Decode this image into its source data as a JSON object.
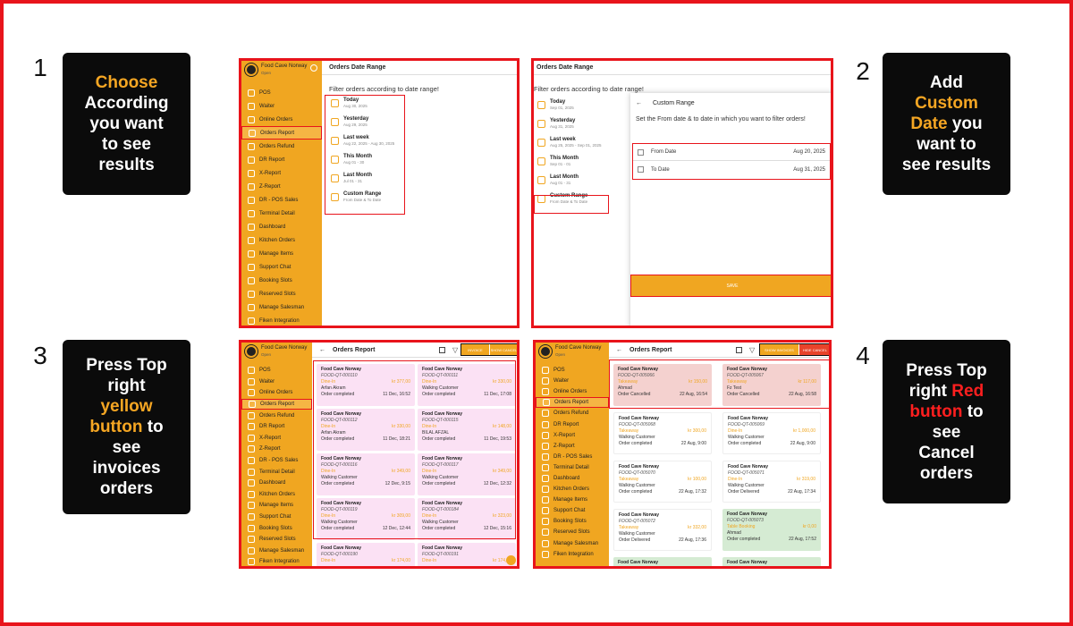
{
  "steps": [
    {
      "num": "1",
      "lines": [
        [
          {
            "t": "Choose",
            "c": "y"
          }
        ],
        [
          {
            "t": "According"
          }
        ],
        [
          {
            "t": "you want"
          }
        ],
        [
          {
            "t": "to see"
          }
        ],
        [
          {
            "t": "results"
          }
        ]
      ]
    },
    {
      "num": "2",
      "lines": [
        [
          {
            "t": "Add"
          }
        ],
        [
          {
            "t": "Custom",
            "c": "y"
          }
        ],
        [
          {
            "t": "Date",
            "c": "y"
          },
          {
            "t": " you"
          }
        ],
        [
          {
            "t": "want to"
          }
        ],
        [
          {
            "t": "see results"
          }
        ]
      ]
    },
    {
      "num": "3",
      "lines": [
        [
          {
            "t": "Press Top"
          }
        ],
        [
          {
            "t": "right"
          }
        ],
        [
          {
            "t": "yellow",
            "c": "y"
          }
        ],
        [
          {
            "t": "button",
            "c": "y"
          },
          {
            "t": " to"
          }
        ],
        [
          {
            "t": "see"
          }
        ],
        [
          {
            "t": "invoices"
          }
        ],
        [
          {
            "t": "orders"
          }
        ]
      ]
    },
    {
      "num": "4",
      "lines": [
        [
          {
            "t": "Press Top"
          }
        ],
        [
          {
            "t": "right "
          },
          {
            "t": "Red",
            "c": "r"
          }
        ],
        [
          {
            "t": "button",
            "c": "r"
          },
          {
            "t": " to"
          }
        ],
        [
          {
            "t": "see"
          }
        ],
        [
          {
            "t": "Cancel"
          }
        ],
        [
          {
            "t": "orders"
          }
        ]
      ]
    }
  ],
  "app": {
    "brand": "Food Cave Norway",
    "brand_sub": "Open"
  },
  "menu_full": [
    "POS",
    "Waiter",
    "Online Orders",
    "Orders Report",
    "Orders Refund",
    "DR Report",
    "X-Report",
    "Z-Report",
    "DR - POS Sales",
    "Terminal Detail",
    "Dashboard",
    "Kitchen Orders",
    "Manage Items",
    "Support Chat",
    "Booking Slots",
    "Reserved Slots",
    "Manage Salesman",
    "Fiken Integration"
  ],
  "shot1": {
    "title": "Orders Date Range",
    "prompt": "Filter orders according to date range!",
    "ranges": [
      {
        "label": "Today",
        "sub": "Aug 30, 2025"
      },
      {
        "label": "Yesterday",
        "sub": "Aug 29, 2025"
      },
      {
        "label": "Last week",
        "sub": "Aug 22, 2025 - Aug 30, 2025"
      },
      {
        "label": "This Month",
        "sub": "Aug 01 - 30"
      },
      {
        "label": "Last Month",
        "sub": "Jul 01 - 31"
      },
      {
        "label": "Custom Range",
        "sub": "From Date & To Date"
      }
    ]
  },
  "shot2": {
    "title": "Orders Date Range",
    "prompt": "Filter orders according to date range!",
    "ranges": [
      {
        "label": "Today",
        "sub": "Sep 01, 2025"
      },
      {
        "label": "Yesterday",
        "sub": "Aug 31, 2025"
      },
      {
        "label": "Last week",
        "sub": "Aug 25, 2025 - Sep 01, 2025"
      },
      {
        "label": "This Month",
        "sub": "Sep 01 - 01"
      },
      {
        "label": "Last Month",
        "sub": "Aug 01 - 31"
      },
      {
        "label": "Custom Range",
        "sub": "From Date & To Date"
      }
    ],
    "dialog_title": "Custom Range",
    "dialog_text": "Set the From date & to date in which you want to filter orders!",
    "from_label": "From Date",
    "from_value": "Aug 20, 2025",
    "to_label": "To Date",
    "to_value": "Aug 31, 2025",
    "save": "SAVE"
  },
  "shot3": {
    "title": "Orders Report",
    "btn_y": "INVOICE",
    "btn_r": "SHOW CANCEL",
    "cards": [
      {
        "n": "Food Cave Norway",
        "id": "FOOD-QT-000110",
        "t": "Dine-In",
        "a": "kr 377,00",
        "c": "Arfan Akram",
        "s": "Order completed",
        "d": "11 Dec, 16:52"
      },
      {
        "n": "Food Cave Norway",
        "id": "FOOD-QT-000111",
        "t": "Dine-In",
        "a": "kr 330,00",
        "c": "Walking Customer",
        "s": "Order completed",
        "d": "11 Dec, 17:08"
      },
      {
        "n": "Food Cave Norway",
        "id": "FOOD-QT-000112",
        "t": "Dine-In",
        "a": "kr 330,00",
        "c": "Arfan Akram",
        "s": "Order completed",
        "d": "11 Dec, 18:21"
      },
      {
        "n": "Food Cave Norway",
        "id": "FOOD-QT-000115",
        "t": "Dine-In",
        "a": "kr 148,00",
        "c": "BILAL AFZAL",
        "s": "Order completed",
        "d": "11 Dec, 19:53"
      },
      {
        "n": "Food Cave Norway",
        "id": "FOOD-QT-000116",
        "t": "Dine-In",
        "a": "kr 349,00",
        "c": "Walking Customer",
        "s": "Order completed",
        "d": "12 Dec, 9:15"
      },
      {
        "n": "Food Cave Norway",
        "id": "FOOD-QT-000117",
        "t": "Dine-In",
        "a": "kr 349,00",
        "c": "Walking Customer",
        "s": "Order completed",
        "d": "12 Dec, 12:32"
      },
      {
        "n": "Food Cave Norway",
        "id": "FOOD-QT-000119",
        "t": "Dine-In",
        "a": "kr 309,00",
        "c": "Walking Customer",
        "s": "Order completed",
        "d": "12 Dec, 12:44"
      },
      {
        "n": "Food Cave Norway",
        "id": "FOOD-QT-000184",
        "t": "Dine-In",
        "a": "kr 323,00",
        "c": "Walking Customer",
        "s": "Order completed",
        "d": "12 Dec, 15:16"
      },
      {
        "n": "Food Cave Norway",
        "id": "FOOD-QT-000190",
        "t": "Dine-In",
        "a": "kr 174,00",
        "c": "",
        "s": "",
        "d": ""
      },
      {
        "n": "Food Cave Norway",
        "id": "FOOD-QT-000191",
        "t": "Dine-In",
        "a": "kr 174,00",
        "c": "",
        "s": "",
        "d": ""
      }
    ]
  },
  "shot4": {
    "title": "Orders Report",
    "btn_y": "SHOW INVOICES",
    "btn_r": "HIDE CANCEL",
    "cards": [
      {
        "n": "Food Cave Norway",
        "id": "FOOD-QT-005066",
        "t": "Takeaway",
        "a": "kr 150,00",
        "c": "Ahmad",
        "s": "Order Cancelled",
        "d": "22 Aug, 16:54",
        "k": "rose"
      },
      {
        "n": "Food Cave Norway",
        "id": "FOOD-QT-005067",
        "t": "Takeaway",
        "a": "kr 117,00",
        "c": "Fz Test",
        "s": "Order Cancelled",
        "d": "22 Aug, 16:58",
        "k": "rose"
      },
      {
        "n": "Food Cave Norway",
        "id": "FOOD-QT-005068",
        "t": "Takeaway",
        "a": "kr 300,00",
        "c": "Walking Customer",
        "s": "Order completed",
        "d": "22 Aug, 9:00",
        "k": "white"
      },
      {
        "n": "Food Cave Norway",
        "id": "FOOD-QT-005069",
        "t": "Dine-In",
        "a": "kr 1,000,00",
        "c": "Walking Customer",
        "s": "Order completed",
        "d": "22 Aug, 9:00",
        "k": "white"
      },
      {
        "n": "Food Cave Norway",
        "id": "FOOD-QT-005070",
        "t": "Takeaway",
        "a": "kr 100,00",
        "c": "Walking Customer",
        "s": "Order completed",
        "d": "22 Aug, 17:32",
        "k": "white"
      },
      {
        "n": "Food Cave Norway",
        "id": "FOOD-QT-005071",
        "t": "Dine-In",
        "a": "kr 319,00",
        "c": "Walking Customer",
        "s": "Order Delivered",
        "d": "22 Aug, 17:34",
        "k": "white"
      },
      {
        "n": "Food Cave Norway",
        "id": "FOOD-QT-005072",
        "t": "Takeaway",
        "a": "kr 332,00",
        "c": "Walking Customer",
        "s": "Order Delivered",
        "d": "22 Aug, 17:36",
        "k": "white"
      },
      {
        "n": "Food Cave Norway",
        "id": "FOOD-QT-005073",
        "t": "Table Booking",
        "a": "kr 0,00",
        "c": "Ahmad",
        "s": "Order completed",
        "d": "22 Aug, 17:52",
        "k": "green"
      },
      {
        "n": "Food Cave Norway",
        "id": "",
        "t": "",
        "a": "",
        "c": "",
        "s": "",
        "d": "",
        "k": "green"
      },
      {
        "n": "Food Cave Norway",
        "id": "",
        "t": "",
        "a": "",
        "c": "",
        "s": "",
        "d": "",
        "k": "green"
      }
    ]
  }
}
